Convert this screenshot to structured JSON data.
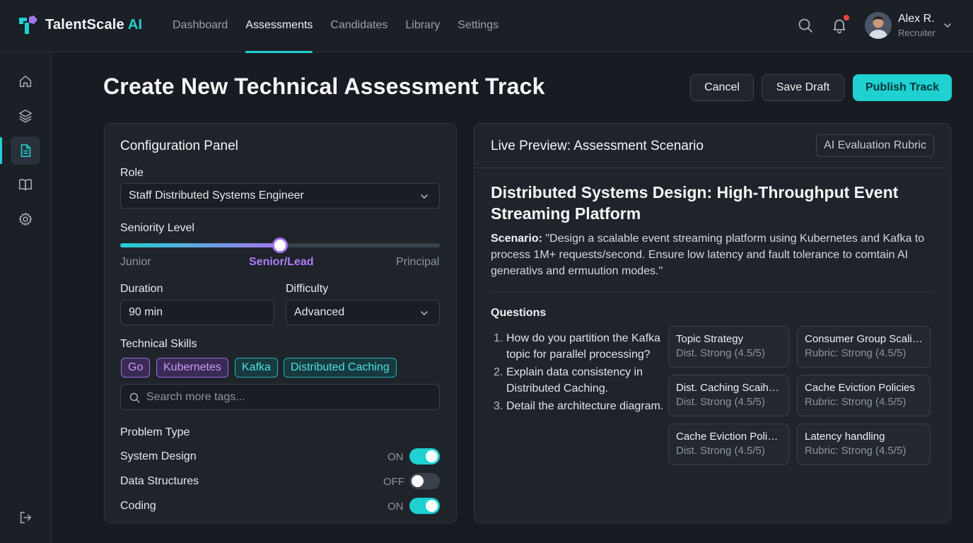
{
  "app": {
    "brand_name": "TalentScale",
    "brand_suffix": "AI"
  },
  "nav": {
    "items": [
      {
        "label": "Dashboard",
        "active": false
      },
      {
        "label": "Assessments",
        "active": true
      },
      {
        "label": "Candidates",
        "active": false
      },
      {
        "label": "Library",
        "active": false
      },
      {
        "label": "Settings",
        "active": false
      }
    ]
  },
  "user": {
    "name": "Alex R.",
    "role": "Recruiter"
  },
  "sidebar": {
    "icons": [
      "home-icon",
      "layers-icon",
      "document-icon",
      "book-icon",
      "gear-icon"
    ],
    "active": "document-icon",
    "bottom_icon": "logout-icon"
  },
  "header": {
    "title": "Create New Technical Assessment Track",
    "cancel_label": "Cancel",
    "save_draft_label": "Save Draft",
    "publish_label": "Publish Track"
  },
  "config": {
    "title": "Configuration Panel",
    "role_label": "Role",
    "role_value": "Staff Distributed Systems Engineer",
    "seniority_label": "Seniority Level",
    "seniority_ticks": [
      "Junior",
      "Senior/Lead",
      "Principal"
    ],
    "seniority_selected": "Senior/Lead",
    "seniority_level_fraction": 0.5,
    "duration_label": "Duration",
    "duration_value": "90 min",
    "difficulty_label": "Difficulty",
    "difficulty_value": "Advanced",
    "skills_label": "Technical Skills",
    "skills": [
      {
        "label": "Go",
        "color": "purple"
      },
      {
        "label": "Kubernetes",
        "color": "purple"
      },
      {
        "label": "Kafka",
        "color": "teal"
      },
      {
        "label": "Distributed Caching",
        "color": "teal"
      }
    ],
    "search_placeholder": "Search more tags...",
    "problem_type_label": "Problem Type",
    "problem_types": [
      {
        "label": "System Design",
        "state": "ON"
      },
      {
        "label": "Data Structures",
        "state": "OFF"
      },
      {
        "label": "Coding",
        "state": "ON"
      }
    ]
  },
  "preview": {
    "title": "Live Preview: Assessment Scenario",
    "rubric_button": "AI Evaluation Rubric",
    "scenario_title": "Distributed Systems Design: High-Throughput Event Streaming Platform",
    "scenario_prefix": "Scenario:",
    "scenario_text": "\"Design a scalable event streaming platform using Kubernetes and Kafka to process 1M+ requests/second. Ensure low latency and fault tolerance to comtain AI generativs and ermuution modes.\"",
    "questions_label": "Questions",
    "questions": [
      "How do you partition the Kafka topic for parallel processing?",
      "Explain data consistency in Distributed Caching.",
      "Detail the architecture diagram."
    ],
    "rubric_cards": [
      {
        "title": "Topic Strategy",
        "sub": "Dist. Strong (4.5/5)"
      },
      {
        "title": "Consumer Group Scaling",
        "sub": "Rubric: Strong (4.5/5)"
      },
      {
        "title": "Dist. Caching Scaihing",
        "sub": "Dist. Strong (4.5/5)"
      },
      {
        "title": "Cache Eviction Policies",
        "sub": "Rubric: Strong (4.5/5)"
      },
      {
        "title": "Cache Eviction Polic...",
        "sub": "Dist. Strong (4.5/5)"
      },
      {
        "title": "Latency handling",
        "sub": "Rubric: Strong (4.5/5)"
      }
    ]
  },
  "colors": {
    "accent": "#1fd1d1",
    "purple": "#a675f0",
    "background": "#181c22",
    "panel": "#1f242b"
  }
}
